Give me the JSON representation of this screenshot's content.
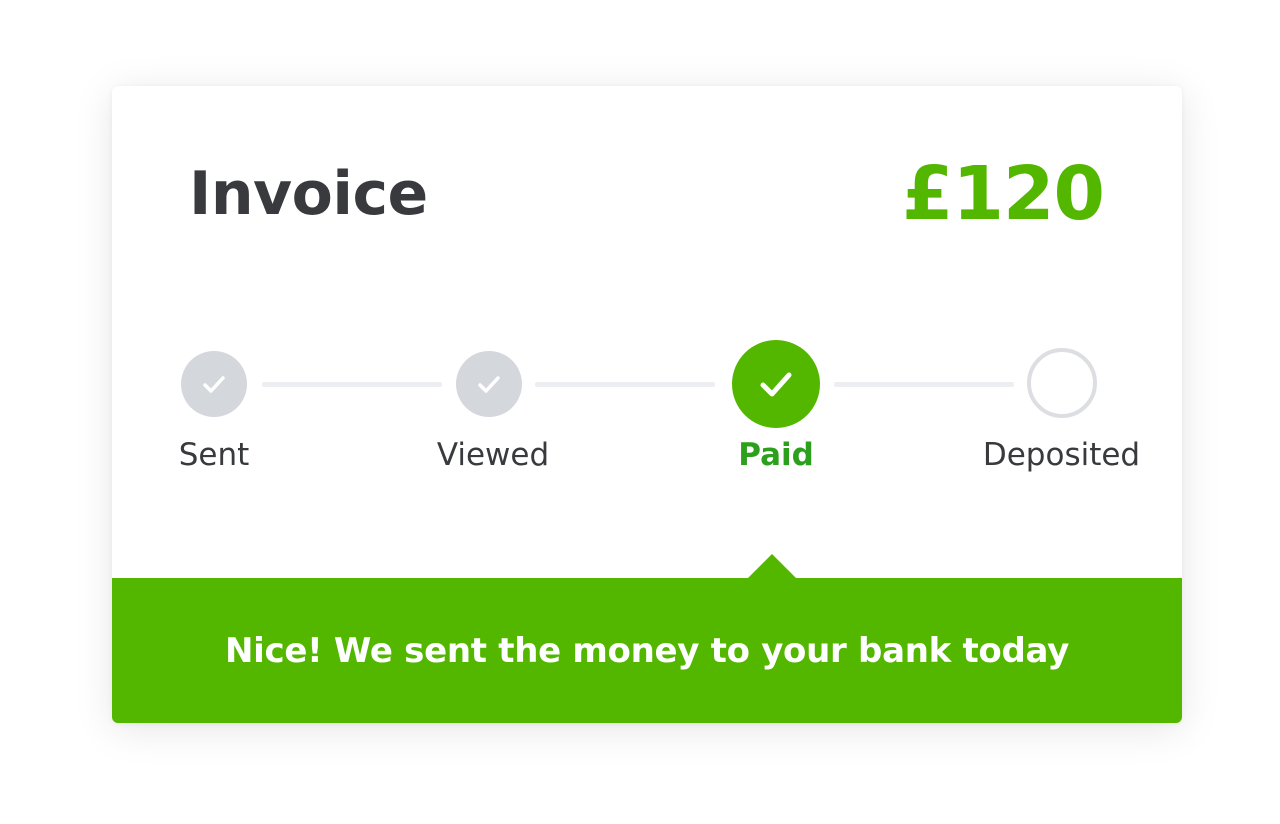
{
  "invoice": {
    "title": "Invoice",
    "amount": "£120"
  },
  "progress": {
    "steps": [
      {
        "label": "Sent",
        "state": "complete",
        "icon": "check-icon"
      },
      {
        "label": "Viewed",
        "state": "complete",
        "icon": "check-icon"
      },
      {
        "label": "Paid",
        "state": "current",
        "icon": "check-icon"
      },
      {
        "label": "Deposited",
        "state": "pending",
        "icon": "empty-circle-icon"
      }
    ]
  },
  "banner": {
    "message": "Nice! We sent the money to your bank today"
  },
  "colors": {
    "accent": "#53b700",
    "accent_text": "#2ca01c",
    "complete_node": "#d4d7dc",
    "text": "#393a3d"
  }
}
